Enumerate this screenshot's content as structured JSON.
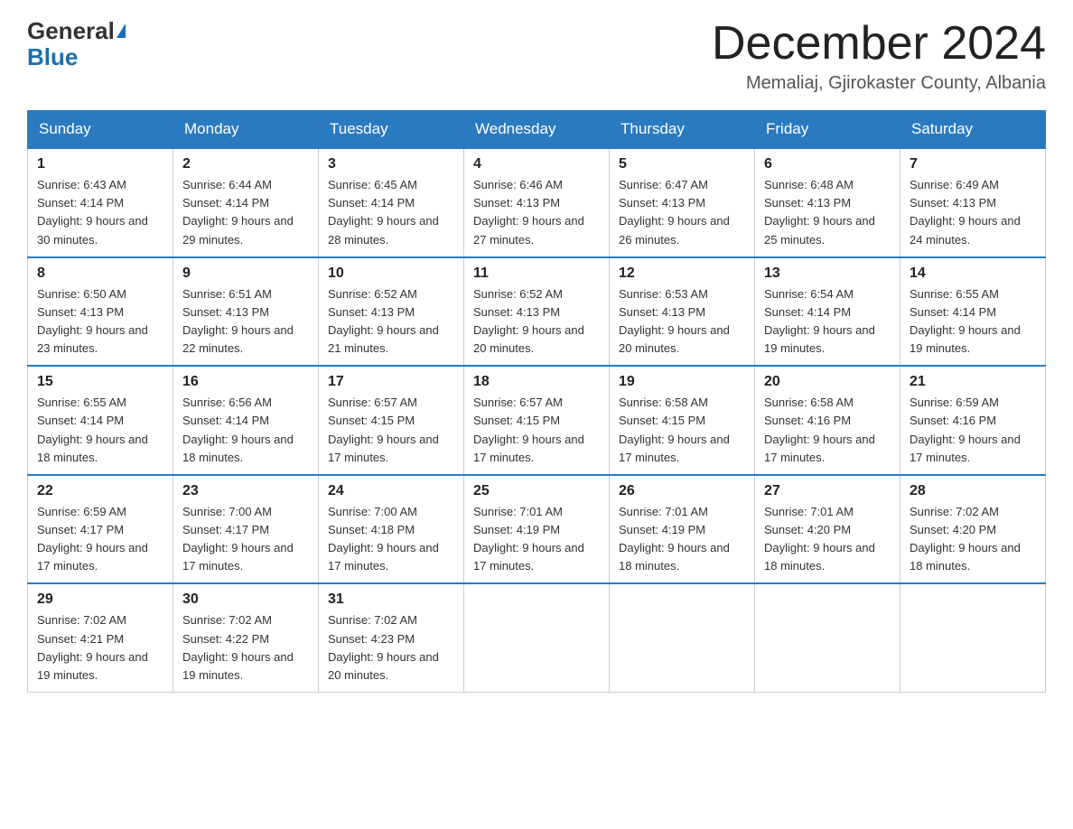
{
  "logo": {
    "general": "General",
    "blue": "Blue"
  },
  "title": {
    "month": "December 2024",
    "location": "Memaliaj, Gjirokaster County, Albania"
  },
  "weekdays": [
    "Sunday",
    "Monday",
    "Tuesday",
    "Wednesday",
    "Thursday",
    "Friday",
    "Saturday"
  ],
  "weeks": [
    [
      {
        "day": "1",
        "sunrise": "6:43 AM",
        "sunset": "4:14 PM",
        "daylight": "9 hours and 30 minutes."
      },
      {
        "day": "2",
        "sunrise": "6:44 AM",
        "sunset": "4:14 PM",
        "daylight": "9 hours and 29 minutes."
      },
      {
        "day": "3",
        "sunrise": "6:45 AM",
        "sunset": "4:14 PM",
        "daylight": "9 hours and 28 minutes."
      },
      {
        "day": "4",
        "sunrise": "6:46 AM",
        "sunset": "4:13 PM",
        "daylight": "9 hours and 27 minutes."
      },
      {
        "day": "5",
        "sunrise": "6:47 AM",
        "sunset": "4:13 PM",
        "daylight": "9 hours and 26 minutes."
      },
      {
        "day": "6",
        "sunrise": "6:48 AM",
        "sunset": "4:13 PM",
        "daylight": "9 hours and 25 minutes."
      },
      {
        "day": "7",
        "sunrise": "6:49 AM",
        "sunset": "4:13 PM",
        "daylight": "9 hours and 24 minutes."
      }
    ],
    [
      {
        "day": "8",
        "sunrise": "6:50 AM",
        "sunset": "4:13 PM",
        "daylight": "9 hours and 23 minutes."
      },
      {
        "day": "9",
        "sunrise": "6:51 AM",
        "sunset": "4:13 PM",
        "daylight": "9 hours and 22 minutes."
      },
      {
        "day": "10",
        "sunrise": "6:52 AM",
        "sunset": "4:13 PM",
        "daylight": "9 hours and 21 minutes."
      },
      {
        "day": "11",
        "sunrise": "6:52 AM",
        "sunset": "4:13 PM",
        "daylight": "9 hours and 20 minutes."
      },
      {
        "day": "12",
        "sunrise": "6:53 AM",
        "sunset": "4:13 PM",
        "daylight": "9 hours and 20 minutes."
      },
      {
        "day": "13",
        "sunrise": "6:54 AM",
        "sunset": "4:14 PM",
        "daylight": "9 hours and 19 minutes."
      },
      {
        "day": "14",
        "sunrise": "6:55 AM",
        "sunset": "4:14 PM",
        "daylight": "9 hours and 19 minutes."
      }
    ],
    [
      {
        "day": "15",
        "sunrise": "6:55 AM",
        "sunset": "4:14 PM",
        "daylight": "9 hours and 18 minutes."
      },
      {
        "day": "16",
        "sunrise": "6:56 AM",
        "sunset": "4:14 PM",
        "daylight": "9 hours and 18 minutes."
      },
      {
        "day": "17",
        "sunrise": "6:57 AM",
        "sunset": "4:15 PM",
        "daylight": "9 hours and 17 minutes."
      },
      {
        "day": "18",
        "sunrise": "6:57 AM",
        "sunset": "4:15 PM",
        "daylight": "9 hours and 17 minutes."
      },
      {
        "day": "19",
        "sunrise": "6:58 AM",
        "sunset": "4:15 PM",
        "daylight": "9 hours and 17 minutes."
      },
      {
        "day": "20",
        "sunrise": "6:58 AM",
        "sunset": "4:16 PM",
        "daylight": "9 hours and 17 minutes."
      },
      {
        "day": "21",
        "sunrise": "6:59 AM",
        "sunset": "4:16 PM",
        "daylight": "9 hours and 17 minutes."
      }
    ],
    [
      {
        "day": "22",
        "sunrise": "6:59 AM",
        "sunset": "4:17 PM",
        "daylight": "9 hours and 17 minutes."
      },
      {
        "day": "23",
        "sunrise": "7:00 AM",
        "sunset": "4:17 PM",
        "daylight": "9 hours and 17 minutes."
      },
      {
        "day": "24",
        "sunrise": "7:00 AM",
        "sunset": "4:18 PM",
        "daylight": "9 hours and 17 minutes."
      },
      {
        "day": "25",
        "sunrise": "7:01 AM",
        "sunset": "4:19 PM",
        "daylight": "9 hours and 17 minutes."
      },
      {
        "day": "26",
        "sunrise": "7:01 AM",
        "sunset": "4:19 PM",
        "daylight": "9 hours and 18 minutes."
      },
      {
        "day": "27",
        "sunrise": "7:01 AM",
        "sunset": "4:20 PM",
        "daylight": "9 hours and 18 minutes."
      },
      {
        "day": "28",
        "sunrise": "7:02 AM",
        "sunset": "4:20 PM",
        "daylight": "9 hours and 18 minutes."
      }
    ],
    [
      {
        "day": "29",
        "sunrise": "7:02 AM",
        "sunset": "4:21 PM",
        "daylight": "9 hours and 19 minutes."
      },
      {
        "day": "30",
        "sunrise": "7:02 AM",
        "sunset": "4:22 PM",
        "daylight": "9 hours and 19 minutes."
      },
      {
        "day": "31",
        "sunrise": "7:02 AM",
        "sunset": "4:23 PM",
        "daylight": "9 hours and 20 minutes."
      },
      null,
      null,
      null,
      null
    ]
  ]
}
